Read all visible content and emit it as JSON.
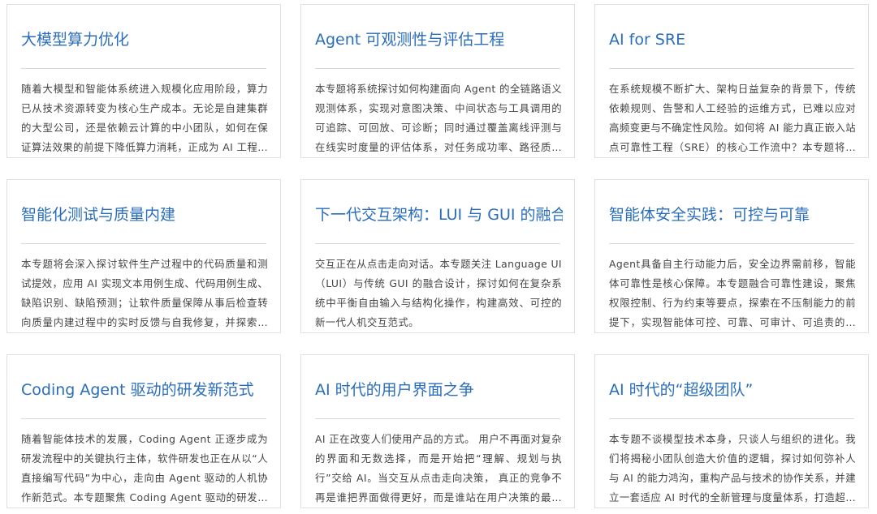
{
  "cards": [
    {
      "title": "大模型算力优化",
      "description": "随着大模型和智能体系统进入规模化应用阶段，算力已从技术资源转变为核心生产成本。无论是自建集群的大型公司，还是依赖云计算的中小团队，如何在保证算法效果的前提下降低算力消耗，正成为 AI 工程落地的关键挑战。"
    },
    {
      "title": "Agent 可观测性与评估工程",
      "description": "本专题将系统探讨如何构建面向 Agent 的全链路语义观测体系，实现对意图决策、中间状态与工具调用的可追踪、可回放、可诊断；同时通过覆盖离线评测与在线实时度量的评估体系，对任务成功率、路径质量等进行量化。"
    },
    {
      "title": "AI for SRE",
      "description": "在系统规模不断扩大、架构日益复杂的背景下，传统依赖规则、告警和人工经验的运维方式，已难以应对高频变更与不确定性风险。如何将 AI 能力真正嵌入站点可靠性工程（SRE）的核心工作流中？本专题将深入探讨。"
    },
    {
      "title": "智能化测试与质量内建",
      "description": "本专题将会深入探讨软件生产过程中的代码质量和测试提效，应用 AI 实现文本用例生成、代码用例生成、缺陷识别、缺陷预测；让软件质量保障从事后检查转向质量内建过程中的实时反馈与自我修复，并探索落地实践。"
    },
    {
      "title": "下一代交互架构：LUI 与 GUI 的融合",
      "description": "交互正在从点击走向对话。本专题关注 Language UI（LUI）与传统 GUI 的融合设计，探讨如何在复杂系统中平衡自由输入与结构化操作，构建高效、可控的新一代人机交互范式。"
    },
    {
      "title": "智能体安全实践：可控与可靠",
      "description": "Agent具备自主行动能力后，安全边界需前移，智能体可靠性是核心保障。本专题融合可靠性建设，聚焦权限控制、行为约束等要点，探索在不压制能力的前提下，实现智能体可控、可靠、可审计、可追责的实践路径。"
    },
    {
      "title": "Coding Agent 驱动的研发新范式",
      "description": "随着智能体技术的发展，Coding Agent 正逐步成为研发流程中的关键执行主体，软件研发也正在从以“人直接编写代码”为中心，走向由 Agent 驱动的人机协作新范式。本专题聚焦 Coding Agent 驱动的研发实践。"
    },
    {
      "title": "AI 时代的用户界面之争",
      "description": "AI 正在改变人们使用产品的方式。 用户不再面对复杂的界面和无数选择，而是开始把“理解、规划与执行”交给 AI。当交互从点击走向决策， 真正的竞争不再是谁把界面做得更好，而是谁站在用户决策的最前端。"
    },
    {
      "title": "AI 时代的“超级团队”",
      "description": "本专题不谈模型技术本身，只谈人与组织的进化。我们将揭秘小团队创造大价值的逻辑，探讨如何弥补人与 AI 的能力鸿沟，重构产品与技术的协作关系，并建立一套适应 AI 时代的全新管理与度量体系，打造超级团队。"
    }
  ]
}
